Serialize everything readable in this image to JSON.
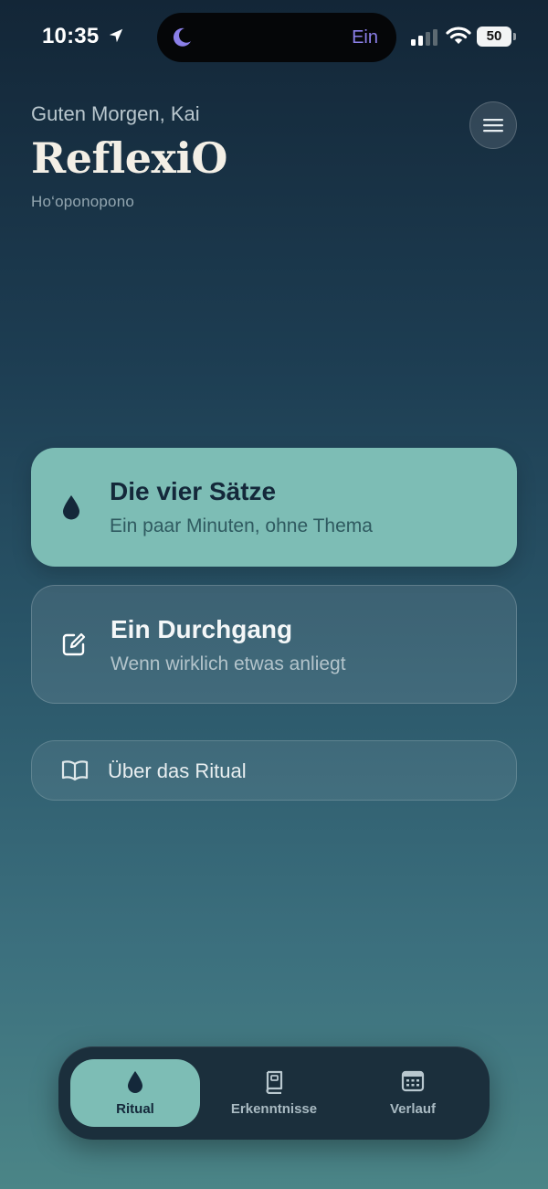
{
  "status_bar": {
    "time": "10:35",
    "focus_label": "Ein",
    "battery": "50",
    "icons": [
      "location-arrow-icon",
      "moon-icon",
      "signal-icon",
      "wifi-icon",
      "battery-icon"
    ]
  },
  "header": {
    "greeting": "Guten Morgen, Kai",
    "title": "ReflexiO",
    "subtitle": "Ho‘oponopono",
    "menu_icon": "menu-icon"
  },
  "cards": [
    {
      "title": "Die vier Sätze",
      "subtitle": "Ein paar Minuten, ohne Thema",
      "icon": "drop-icon"
    },
    {
      "title": "Ein Durchgang",
      "subtitle": "Wenn wirklich etwas anliegt",
      "icon": "edit-icon"
    }
  ],
  "link": {
    "label": "Über das Ritual",
    "icon": "book-open-icon"
  },
  "tabbar": {
    "tabs": [
      {
        "label": "Ritual",
        "icon": "drop-icon",
        "active": true
      },
      {
        "label": "Erkenntnisse",
        "icon": "book-icon",
        "active": false
      },
      {
        "label": "Verlauf",
        "icon": "calendar-icon",
        "active": false
      }
    ]
  },
  "colors": {
    "accent": "#7dbdb5",
    "background_top": "#132637",
    "background_bottom": "#4b8587",
    "tabbar": "#1b2f3c",
    "focus": "#8b7fe8"
  }
}
